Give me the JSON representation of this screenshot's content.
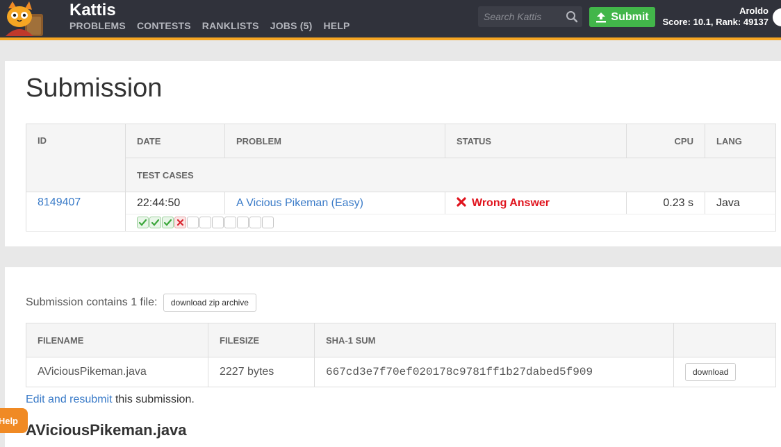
{
  "brand": "Kattis",
  "nav": [
    "PROBLEMS",
    "CONTESTS",
    "RANKLISTS",
    "JOBS (5)",
    "HELP"
  ],
  "search": {
    "placeholder": "Search Kattis"
  },
  "submit_label": "Submit",
  "user": {
    "name": "Aroldo",
    "score_line": "Score: 10.1, Rank: 49137"
  },
  "colors": {
    "topbar": "#30323b",
    "accent": "#f5a623",
    "submit": "#42b64a",
    "wrong": "#e0141e",
    "link": "#3a7bc8",
    "help": "#f08a24"
  },
  "submission": {
    "heading": "Submission",
    "headers": {
      "id": "ID",
      "date": "DATE",
      "problem": "PROBLEM",
      "status": "STATUS",
      "cpu": "CPU",
      "lang": "LANG",
      "test_cases": "TEST CASES"
    },
    "row": {
      "id": "8149407",
      "date": "22:44:50",
      "problem": "A Vicious Pikeman (Easy)",
      "status": "Wrong Answer",
      "cpu": "0.23 s",
      "lang": "Java"
    },
    "test_cases": [
      "accepted",
      "accepted",
      "accepted",
      "wrong",
      "pending",
      "pending",
      "pending",
      "pending",
      "pending",
      "pending",
      "pending"
    ]
  },
  "files": {
    "contains_text": "Submission contains 1 file:",
    "zip_label": "download zip archive",
    "headers": {
      "filename": "FILENAME",
      "filesize": "FILESIZE",
      "sha": "SHA-1 SUM"
    },
    "row": {
      "filename": "AViciousPikeman.java",
      "filesize": "2227 bytes",
      "sha": "667cd3e7f70ef020178c9781ff1b27dabed5f909",
      "download": "download"
    },
    "edit_link": "Edit and resubmit",
    "edit_suffix": " this submission.",
    "file_heading": "AViciousPikeman.java"
  },
  "help_tab": "Help"
}
